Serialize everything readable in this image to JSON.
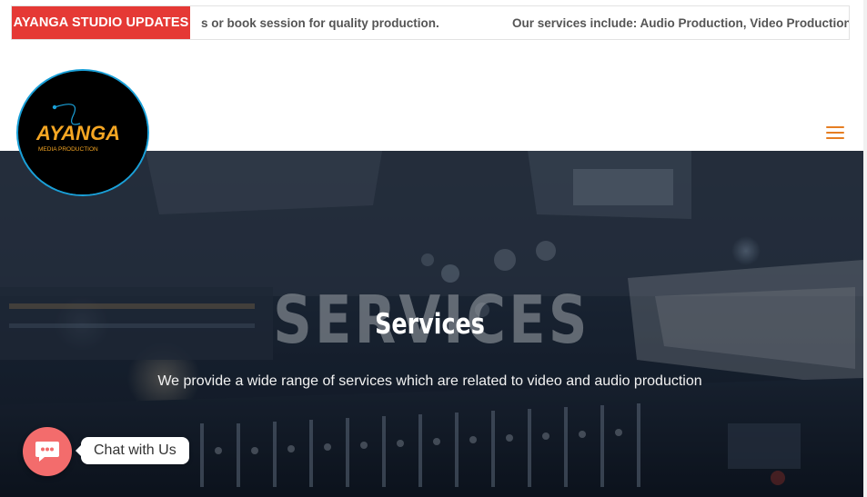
{
  "ticker": {
    "label": "AYANGA STUDIO UPDATES",
    "items": [
      "s or book session for quality production.",
      "Our services include: Audio Production, Video Production,"
    ]
  },
  "logo": {
    "brand": "AYANGA",
    "tagline": "MEDIA PRODUCTION"
  },
  "header": {
    "menu_icon": "hamburger-menu-icon"
  },
  "hero": {
    "watermark": "SERVICES",
    "title": "Services",
    "subtitle": "We provide a wide range of services which are related to video and audio production"
  },
  "chat": {
    "label": "Chat with Us",
    "icon": "chat-bubble-icon"
  },
  "colors": {
    "accent_red": "#e53935",
    "menu_orange": "#e67e22",
    "logo_ring": "#1aa0d8",
    "chat_pink": "#f36c6c"
  }
}
